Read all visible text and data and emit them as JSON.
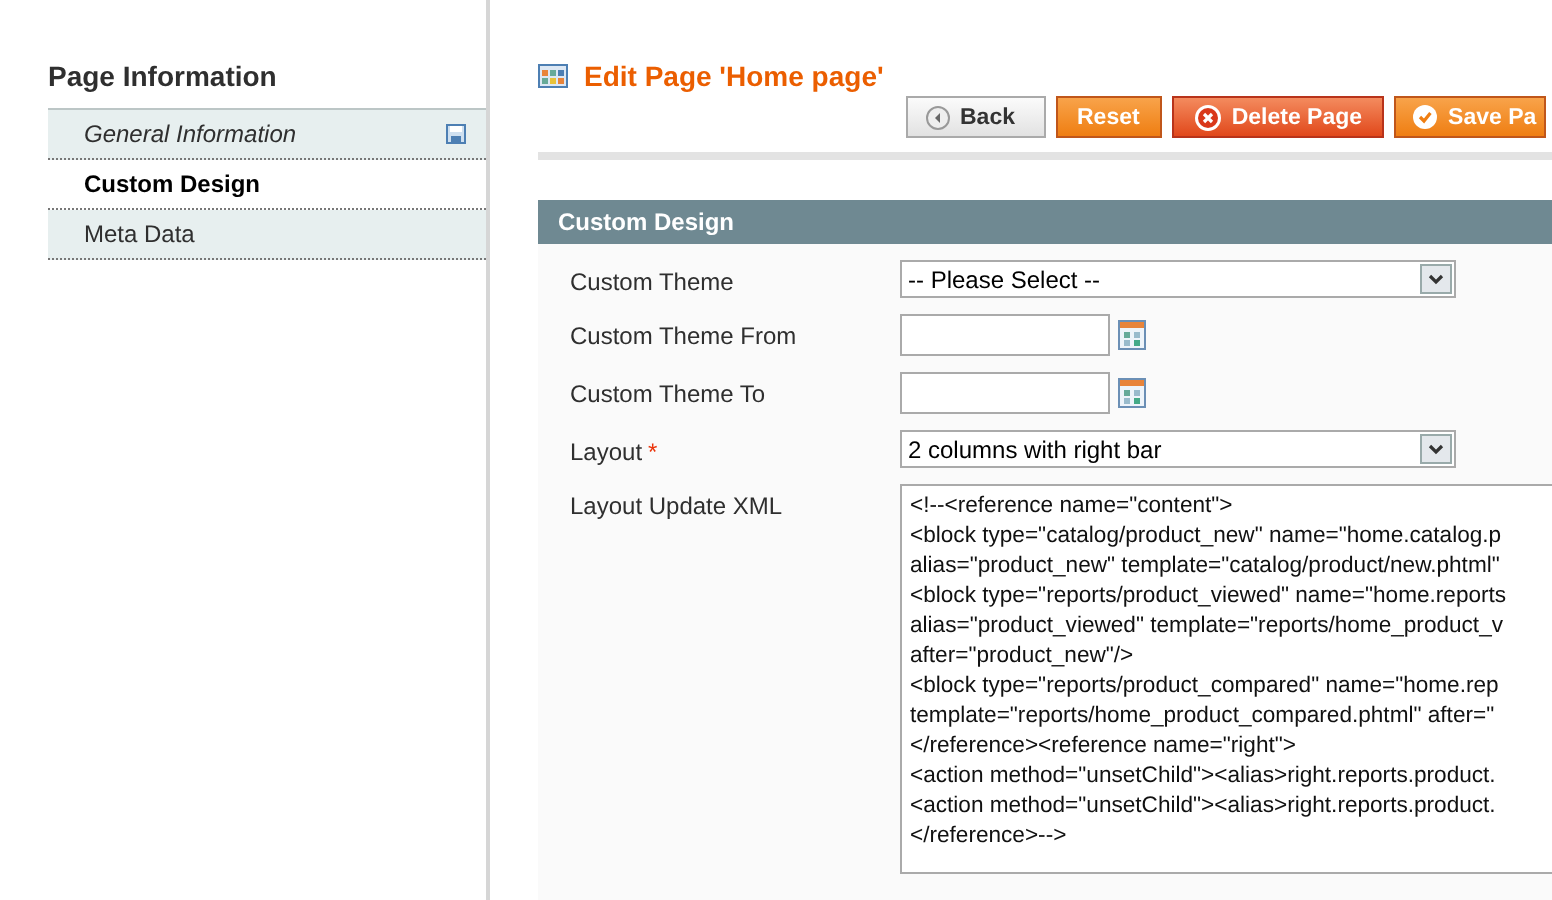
{
  "sidebar": {
    "title": "Page Information",
    "tabs": [
      {
        "label": "General Information",
        "selected": false,
        "italic": true,
        "changed": true
      },
      {
        "label": "Custom Design",
        "selected": true,
        "italic": false,
        "changed": false
      },
      {
        "label": "Meta Data",
        "selected": false,
        "italic": false,
        "changed": false
      }
    ]
  },
  "page": {
    "title": "Edit Page 'Home page'"
  },
  "buttons": [
    {
      "label": "Back",
      "kind": "back"
    },
    {
      "label": "Reset",
      "kind": "reset"
    },
    {
      "label": "Delete Page",
      "kind": "delete"
    },
    {
      "label": "Save Pa",
      "kind": "save"
    }
  ],
  "section": {
    "title": "Custom Design",
    "fields": [
      {
        "label": "Custom Theme",
        "kind": "select",
        "value": "-- Please Select --"
      },
      {
        "label": "Custom Theme From",
        "kind": "date"
      },
      {
        "label": "Custom Theme To",
        "kind": "date"
      },
      {
        "label": "Layout",
        "kind": "select",
        "value": "2 columns with right bar",
        "required_mark": "*"
      },
      {
        "label": "Layout Update XML",
        "kind": "textarea",
        "lines": [
          "<!--<reference name=\"content\">",
          "<block type=\"catalog/product_new\" name=\"home.catalog.p",
          "alias=\"product_new\" template=\"catalog/product/new.phtml\"",
          "<block type=\"reports/product_viewed\" name=\"home.reports",
          "alias=\"product_viewed\" template=\"reports/home_product_v",
          "after=\"product_new\"/>",
          "<block type=\"reports/product_compared\" name=\"home.rep",
          "template=\"reports/home_product_compared.phtml\" after=\"",
          "</reference><reference name=\"right\">",
          "<action method=\"unsetChild\"><alias>right.reports.product.",
          "<action method=\"unsetChild\"><alias>right.reports.product.",
          "</reference>-->"
        ]
      }
    ]
  }
}
